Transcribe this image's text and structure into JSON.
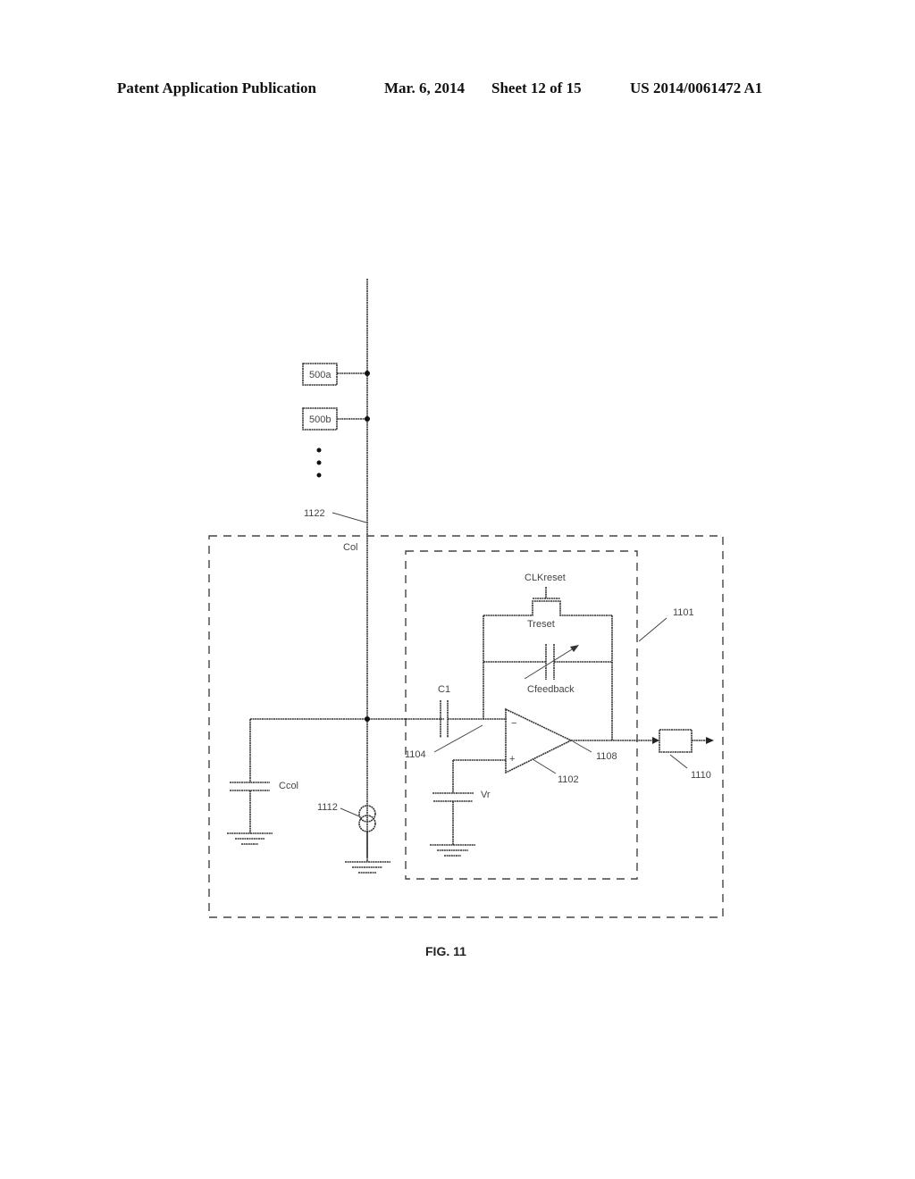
{
  "header": {
    "publication": "Patent Application Publication",
    "date": "Mar. 6, 2014",
    "sheet": "Sheet 12 of 15",
    "number": "US 2014/0061472 A1"
  },
  "figure": {
    "caption": "FIG. 11",
    "labels": {
      "pixel_a": "500a",
      "pixel_b": "500b",
      "column_line_ref": "1122",
      "column_label": "Col",
      "readout_block_ref": "1101",
      "clk_reset": "CLKreset",
      "t_reset": "Treset",
      "c_feedback": "Cfeedback",
      "c1": "C1",
      "c1_ref": "1104",
      "opamp_ref": "1102",
      "output_ref": "1108",
      "buffer_ref": "1110",
      "c_col": "Ccol",
      "current_source_ref": "1112",
      "vr": "Vr",
      "minus_sign": "−",
      "plus_sign": "+"
    }
  }
}
